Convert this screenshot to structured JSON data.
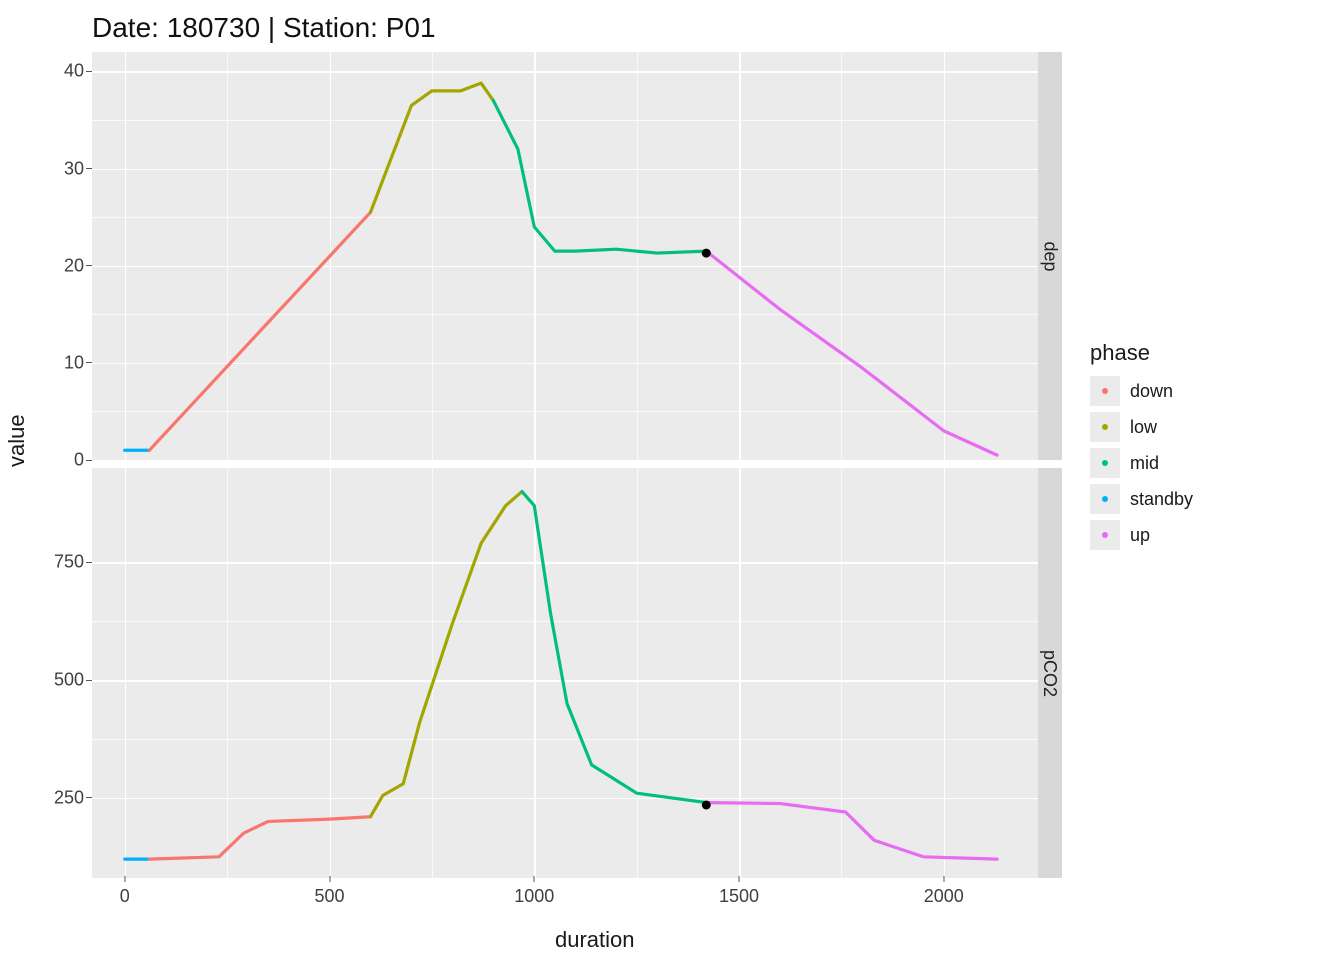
{
  "title": "Date: 180730 | Station: P01",
  "xlabel": "duration",
  "ylabel": "value",
  "facets": {
    "dep": {
      "label": "dep",
      "ylim": [
        42,
        0
      ],
      "yticks": [
        0,
        10,
        20,
        30,
        40
      ]
    },
    "pco2": {
      "label": "pCO2",
      "ylim": [
        950,
        80
      ],
      "yticks": [
        250,
        500,
        750
      ]
    }
  },
  "xlim": [
    -80,
    2230
  ],
  "xticks": [
    0,
    500,
    1000,
    1500,
    2000
  ],
  "legend": {
    "title": "phase",
    "items": [
      {
        "name": "down",
        "color": "#F8766D"
      },
      {
        "name": "low",
        "color": "#A3A500"
      },
      {
        "name": "mid",
        "color": "#00BF7D"
      },
      {
        "name": "standby",
        "color": "#00B0F6"
      },
      {
        "name": "up",
        "color": "#E76BF3"
      }
    ]
  },
  "chart_data": [
    {
      "facet": "dep",
      "type": "line",
      "title": "",
      "xlabel": "duration",
      "ylabel": "value",
      "ylim": [
        42,
        0
      ],
      "series": [
        {
          "name": "standby",
          "x": [
            0,
            60
          ],
          "values": [
            1.0,
            1.0
          ]
        },
        {
          "name": "down",
          "x": [
            60,
            600
          ],
          "values": [
            1.0,
            25.5
          ]
        },
        {
          "name": "low",
          "x": [
            600,
            700,
            750,
            820,
            870,
            900
          ],
          "values": [
            25.5,
            36.5,
            38.0,
            38.0,
            38.8,
            37.0
          ]
        },
        {
          "name": "mid",
          "x": [
            900,
            960,
            1000,
            1050,
            1100,
            1200,
            1300,
            1420
          ],
          "values": [
            37.0,
            32.0,
            24.0,
            21.5,
            21.5,
            21.7,
            21.3,
            21.5
          ]
        },
        {
          "name": "up",
          "x": [
            1420,
            1600,
            1800,
            2000,
            2130
          ],
          "values": [
            21.5,
            15.5,
            9.5,
            3.0,
            0.5
          ]
        }
      ],
      "marker": {
        "x": 1420,
        "y": 21.3
      }
    },
    {
      "facet": "pco2",
      "type": "line",
      "title": "",
      "xlabel": "duration",
      "ylabel": "value",
      "ylim": [
        950,
        80
      ],
      "series": [
        {
          "name": "standby",
          "x": [
            0,
            60
          ],
          "values": [
            120,
            120
          ]
        },
        {
          "name": "down",
          "x": [
            60,
            230,
            290,
            350,
            500,
            600
          ],
          "values": [
            120,
            125,
            175,
            200,
            205,
            210
          ]
        },
        {
          "name": "low",
          "x": [
            600,
            630,
            680,
            720,
            800,
            870,
            930,
            970
          ],
          "values": [
            210,
            255,
            280,
            410,
            620,
            790,
            870,
            900
          ]
        },
        {
          "name": "mid",
          "x": [
            970,
            1000,
            1040,
            1080,
            1140,
            1250,
            1420
          ],
          "values": [
            900,
            870,
            640,
            450,
            320,
            260,
            240
          ]
        },
        {
          "name": "up",
          "x": [
            1420,
            1600,
            1760,
            1830,
            1950,
            2130
          ],
          "values": [
            240,
            238,
            220,
            160,
            125,
            120
          ]
        }
      ],
      "marker": {
        "x": 1420,
        "y": 235
      }
    }
  ]
}
